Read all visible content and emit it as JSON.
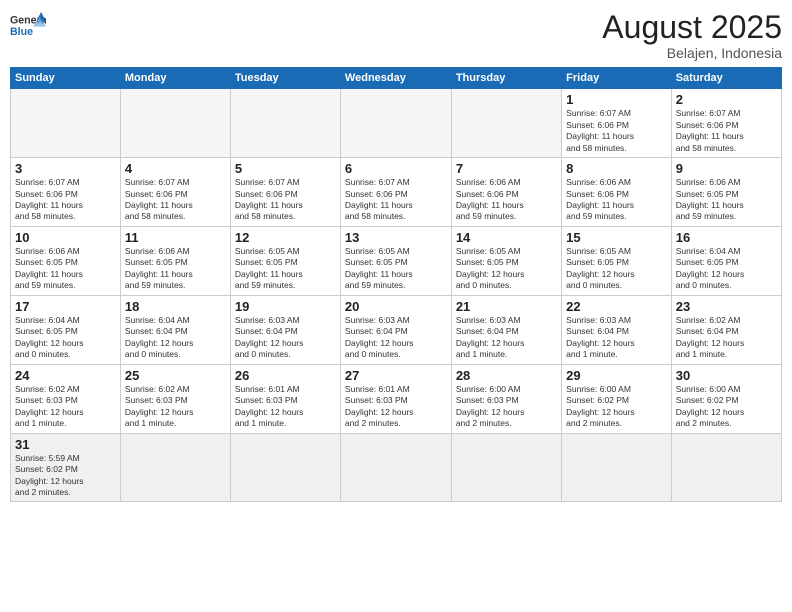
{
  "header": {
    "logo_general": "General",
    "logo_blue": "Blue",
    "month_title": "August 2025",
    "subtitle": "Belajen, Indonesia"
  },
  "weekdays": [
    "Sunday",
    "Monday",
    "Tuesday",
    "Wednesday",
    "Thursday",
    "Friday",
    "Saturday"
  ],
  "rows": [
    [
      {
        "day": "",
        "info": ""
      },
      {
        "day": "",
        "info": ""
      },
      {
        "day": "",
        "info": ""
      },
      {
        "day": "",
        "info": ""
      },
      {
        "day": "",
        "info": ""
      },
      {
        "day": "1",
        "info": "Sunrise: 6:07 AM\nSunset: 6:06 PM\nDaylight: 11 hours\nand 58 minutes."
      },
      {
        "day": "2",
        "info": "Sunrise: 6:07 AM\nSunset: 6:06 PM\nDaylight: 11 hours\nand 58 minutes."
      }
    ],
    [
      {
        "day": "3",
        "info": "Sunrise: 6:07 AM\nSunset: 6:06 PM\nDaylight: 11 hours\nand 58 minutes."
      },
      {
        "day": "4",
        "info": "Sunrise: 6:07 AM\nSunset: 6:06 PM\nDaylight: 11 hours\nand 58 minutes."
      },
      {
        "day": "5",
        "info": "Sunrise: 6:07 AM\nSunset: 6:06 PM\nDaylight: 11 hours\nand 58 minutes."
      },
      {
        "day": "6",
        "info": "Sunrise: 6:07 AM\nSunset: 6:06 PM\nDaylight: 11 hours\nand 58 minutes."
      },
      {
        "day": "7",
        "info": "Sunrise: 6:06 AM\nSunset: 6:06 PM\nDaylight: 11 hours\nand 59 minutes."
      },
      {
        "day": "8",
        "info": "Sunrise: 6:06 AM\nSunset: 6:06 PM\nDaylight: 11 hours\nand 59 minutes."
      },
      {
        "day": "9",
        "info": "Sunrise: 6:06 AM\nSunset: 6:05 PM\nDaylight: 11 hours\nand 59 minutes."
      }
    ],
    [
      {
        "day": "10",
        "info": "Sunrise: 6:06 AM\nSunset: 6:05 PM\nDaylight: 11 hours\nand 59 minutes."
      },
      {
        "day": "11",
        "info": "Sunrise: 6:06 AM\nSunset: 6:05 PM\nDaylight: 11 hours\nand 59 minutes."
      },
      {
        "day": "12",
        "info": "Sunrise: 6:05 AM\nSunset: 6:05 PM\nDaylight: 11 hours\nand 59 minutes."
      },
      {
        "day": "13",
        "info": "Sunrise: 6:05 AM\nSunset: 6:05 PM\nDaylight: 11 hours\nand 59 minutes."
      },
      {
        "day": "14",
        "info": "Sunrise: 6:05 AM\nSunset: 6:05 PM\nDaylight: 12 hours\nand 0 minutes."
      },
      {
        "day": "15",
        "info": "Sunrise: 6:05 AM\nSunset: 6:05 PM\nDaylight: 12 hours\nand 0 minutes."
      },
      {
        "day": "16",
        "info": "Sunrise: 6:04 AM\nSunset: 6:05 PM\nDaylight: 12 hours\nand 0 minutes."
      }
    ],
    [
      {
        "day": "17",
        "info": "Sunrise: 6:04 AM\nSunset: 6:05 PM\nDaylight: 12 hours\nand 0 minutes."
      },
      {
        "day": "18",
        "info": "Sunrise: 6:04 AM\nSunset: 6:04 PM\nDaylight: 12 hours\nand 0 minutes."
      },
      {
        "day": "19",
        "info": "Sunrise: 6:03 AM\nSunset: 6:04 PM\nDaylight: 12 hours\nand 0 minutes."
      },
      {
        "day": "20",
        "info": "Sunrise: 6:03 AM\nSunset: 6:04 PM\nDaylight: 12 hours\nand 0 minutes."
      },
      {
        "day": "21",
        "info": "Sunrise: 6:03 AM\nSunset: 6:04 PM\nDaylight: 12 hours\nand 1 minute."
      },
      {
        "day": "22",
        "info": "Sunrise: 6:03 AM\nSunset: 6:04 PM\nDaylight: 12 hours\nand 1 minute."
      },
      {
        "day": "23",
        "info": "Sunrise: 6:02 AM\nSunset: 6:04 PM\nDaylight: 12 hours\nand 1 minute."
      }
    ],
    [
      {
        "day": "24",
        "info": "Sunrise: 6:02 AM\nSunset: 6:03 PM\nDaylight: 12 hours\nand 1 minute."
      },
      {
        "day": "25",
        "info": "Sunrise: 6:02 AM\nSunset: 6:03 PM\nDaylight: 12 hours\nand 1 minute."
      },
      {
        "day": "26",
        "info": "Sunrise: 6:01 AM\nSunset: 6:03 PM\nDaylight: 12 hours\nand 1 minute."
      },
      {
        "day": "27",
        "info": "Sunrise: 6:01 AM\nSunset: 6:03 PM\nDaylight: 12 hours\nand 2 minutes."
      },
      {
        "day": "28",
        "info": "Sunrise: 6:00 AM\nSunset: 6:03 PM\nDaylight: 12 hours\nand 2 minutes."
      },
      {
        "day": "29",
        "info": "Sunrise: 6:00 AM\nSunset: 6:02 PM\nDaylight: 12 hours\nand 2 minutes."
      },
      {
        "day": "30",
        "info": "Sunrise: 6:00 AM\nSunset: 6:02 PM\nDaylight: 12 hours\nand 2 minutes."
      }
    ],
    [
      {
        "day": "31",
        "info": "Sunrise: 5:59 AM\nSunset: 6:02 PM\nDaylight: 12 hours\nand 2 minutes."
      },
      {
        "day": "",
        "info": ""
      },
      {
        "day": "",
        "info": ""
      },
      {
        "day": "",
        "info": ""
      },
      {
        "day": "",
        "info": ""
      },
      {
        "day": "",
        "info": ""
      },
      {
        "day": "",
        "info": ""
      }
    ]
  ]
}
